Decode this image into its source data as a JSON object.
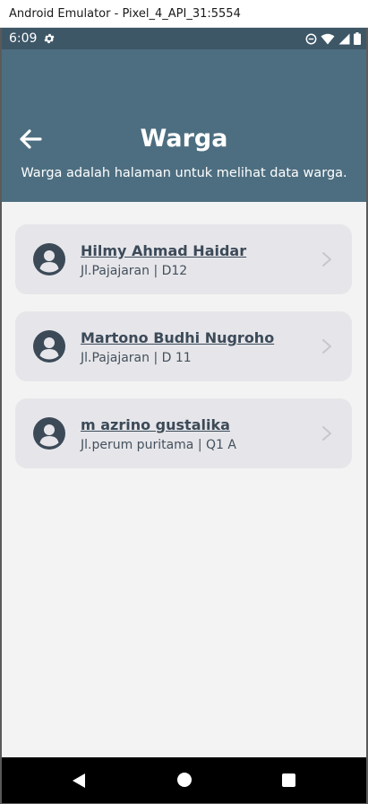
{
  "window": {
    "title": "Android Emulator - Pixel_4_API_31:5554"
  },
  "status_bar": {
    "time": "6:09",
    "icons": [
      "settings-gear-icon",
      "do-not-disturb-icon",
      "wifi-icon",
      "cell-signal-icon",
      "battery-icon"
    ]
  },
  "header": {
    "title": "Warga",
    "subtitle": "Warga adalah halaman untuk melihat data warga.",
    "background_color": "#4d6e80",
    "status_color": "#3d5767"
  },
  "residents": [
    {
      "name": "Hilmy Ahmad Haidar",
      "address": "Jl.Pajajaran | D12"
    },
    {
      "name": "Martono Budhi Nugroho",
      "address": "Jl.Pajajaran | D 11"
    },
    {
      "name": "m azrino gustalika",
      "address": "Jl.perum puritama | Q1 A"
    }
  ],
  "colors": {
    "card_background": "#e6e6ea",
    "avatar": "#3c4a58",
    "page_background": "#f3f3f3"
  }
}
